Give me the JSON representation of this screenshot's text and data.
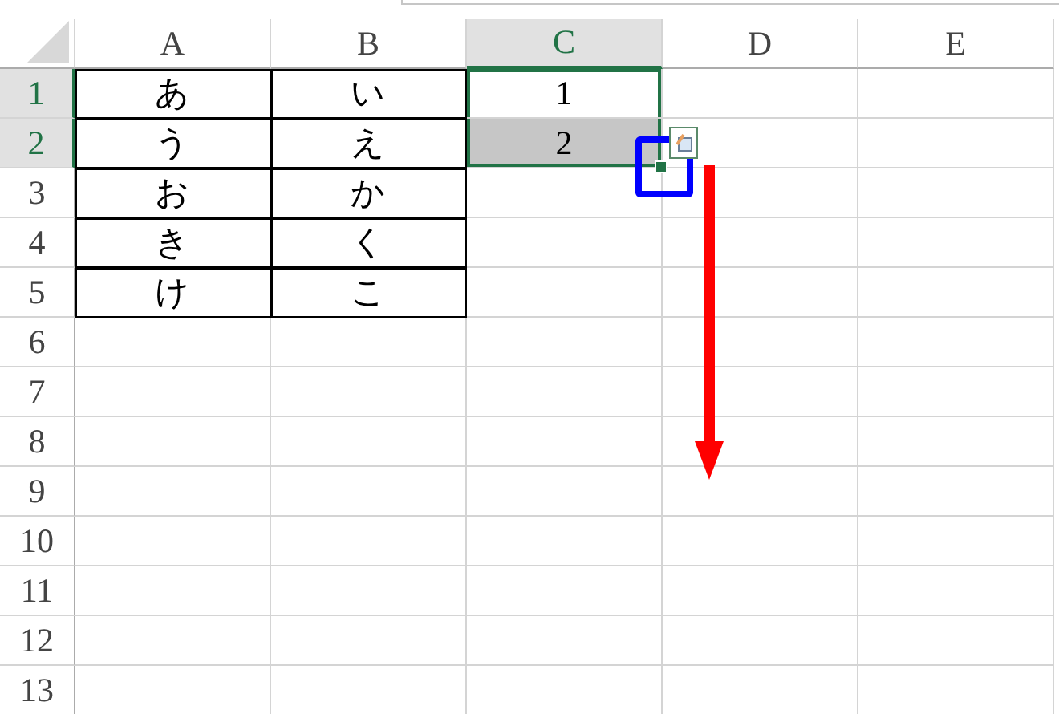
{
  "columns": [
    {
      "label": "A",
      "selected": false
    },
    {
      "label": "B",
      "selected": false
    },
    {
      "label": "C",
      "selected": true
    },
    {
      "label": "D",
      "selected": false
    },
    {
      "label": "E",
      "selected": false
    }
  ],
  "rows": [
    {
      "label": "1",
      "selected": true,
      "cells": [
        {
          "value": "あ",
          "bordered": true,
          "selected": false
        },
        {
          "value": "い",
          "bordered": true,
          "selected": false
        },
        {
          "value": "1",
          "bordered": false,
          "selected": true
        },
        {
          "bordered": false,
          "selected": false
        },
        {
          "bordered": false,
          "selected": false
        }
      ]
    },
    {
      "label": "2",
      "selected": true,
      "cells": [
        {
          "value": "う",
          "bordered": true,
          "selected": false
        },
        {
          "value": "え",
          "bordered": true,
          "selected": false
        },
        {
          "value": "2",
          "bordered": false,
          "selected": true
        },
        {
          "bordered": false,
          "selected": false
        },
        {
          "bordered": false,
          "selected": false
        }
      ]
    },
    {
      "label": "3",
      "selected": false,
      "cells": [
        {
          "value": "お",
          "bordered": true,
          "selected": false
        },
        {
          "value": "か",
          "bordered": true,
          "selected": false
        },
        {
          "bordered": false,
          "selected": false
        },
        {
          "bordered": false,
          "selected": false
        },
        {
          "bordered": false,
          "selected": false
        }
      ]
    },
    {
      "label": "4",
      "selected": false,
      "cells": [
        {
          "value": "き",
          "bordered": true,
          "selected": false
        },
        {
          "value": "く",
          "bordered": true,
          "selected": false
        },
        {
          "bordered": false,
          "selected": false
        },
        {
          "bordered": false,
          "selected": false
        },
        {
          "bordered": false,
          "selected": false
        }
      ]
    },
    {
      "label": "5",
      "selected": false,
      "cells": [
        {
          "value": "け",
          "bordered": true,
          "selected": false
        },
        {
          "value": "こ",
          "bordered": true,
          "selected": false
        },
        {
          "bordered": false,
          "selected": false
        },
        {
          "bordered": false,
          "selected": false
        },
        {
          "bordered": false,
          "selected": false
        }
      ]
    },
    {
      "label": "6",
      "selected": false,
      "cells": [
        {
          "bordered": false,
          "selected": false
        },
        {
          "bordered": false,
          "selected": false
        },
        {
          "bordered": false,
          "selected": false
        },
        {
          "bordered": false,
          "selected": false
        },
        {
          "bordered": false,
          "selected": false
        }
      ]
    },
    {
      "label": "7",
      "selected": false,
      "cells": [
        {
          "bordered": false,
          "selected": false
        },
        {
          "bordered": false,
          "selected": false
        },
        {
          "bordered": false,
          "selected": false
        },
        {
          "bordered": false,
          "selected": false
        },
        {
          "bordered": false,
          "selected": false
        }
      ]
    },
    {
      "label": "8",
      "selected": false,
      "cells": [
        {
          "bordered": false,
          "selected": false
        },
        {
          "bordered": false,
          "selected": false
        },
        {
          "bordered": false,
          "selected": false
        },
        {
          "bordered": false,
          "selected": false
        },
        {
          "bordered": false,
          "selected": false
        }
      ]
    },
    {
      "label": "9",
      "selected": false,
      "cells": [
        {
          "bordered": false,
          "selected": false
        },
        {
          "bordered": false,
          "selected": false
        },
        {
          "bordered": false,
          "selected": false
        },
        {
          "bordered": false,
          "selected": false
        },
        {
          "bordered": false,
          "selected": false
        }
      ]
    },
    {
      "label": "10",
      "selected": false,
      "cells": [
        {
          "bordered": false,
          "selected": false
        },
        {
          "bordered": false,
          "selected": false
        },
        {
          "bordered": false,
          "selected": false
        },
        {
          "bordered": false,
          "selected": false
        },
        {
          "bordered": false,
          "selected": false
        }
      ]
    },
    {
      "label": "11",
      "selected": false,
      "cells": [
        {
          "bordered": false,
          "selected": false
        },
        {
          "bordered": false,
          "selected": false
        },
        {
          "bordered": false,
          "selected": false
        },
        {
          "bordered": false,
          "selected": false
        },
        {
          "bordered": false,
          "selected": false
        }
      ]
    },
    {
      "label": "12",
      "selected": false,
      "cells": [
        {
          "bordered": false,
          "selected": false
        },
        {
          "bordered": false,
          "selected": false
        },
        {
          "bordered": false,
          "selected": false
        },
        {
          "bordered": false,
          "selected": false
        },
        {
          "bordered": false,
          "selected": false
        }
      ]
    },
    {
      "label": "13",
      "selected": false,
      "cells": [
        {
          "bordered": false,
          "selected": false
        },
        {
          "bordered": false,
          "selected": false
        },
        {
          "bordered": false,
          "selected": false
        },
        {
          "bordered": false,
          "selected": false
        },
        {
          "bordered": false,
          "selected": false
        }
      ]
    }
  ],
  "autofill_options_shown": true,
  "highlight_box_shown": true,
  "down_arrow_shown": true
}
